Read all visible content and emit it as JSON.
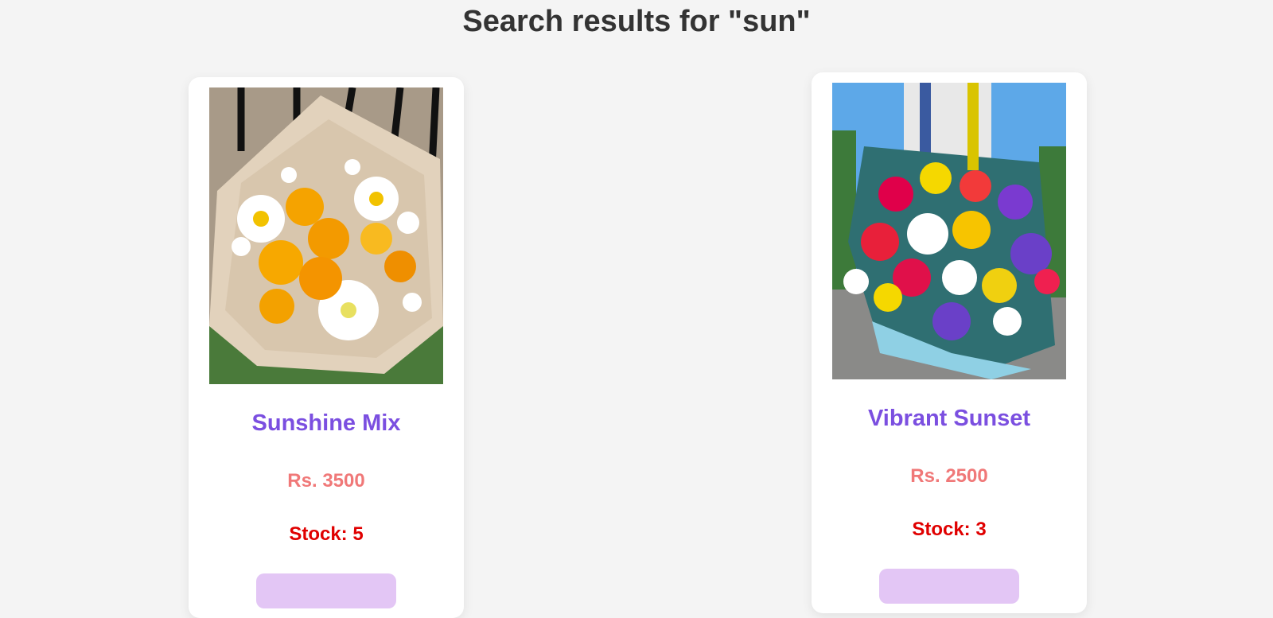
{
  "page": {
    "title": "Search results for \"sun\""
  },
  "products": [
    {
      "name": "Sunshine Mix",
      "price": "Rs. 3500",
      "stock": "Stock: 5",
      "image": "yellow-white-flower-bouquet"
    },
    {
      "name": "Vibrant Sunset",
      "price": "Rs. 2500",
      "stock": "Stock: 3",
      "image": "mixed-colorful-flower-bouquet"
    }
  ],
  "colors": {
    "background": "#f4f4f4",
    "title": "#333333",
    "product_name": "#7b4fe0",
    "price": "#f07878",
    "stock": "#e00000",
    "button": "#e3c6f5"
  }
}
